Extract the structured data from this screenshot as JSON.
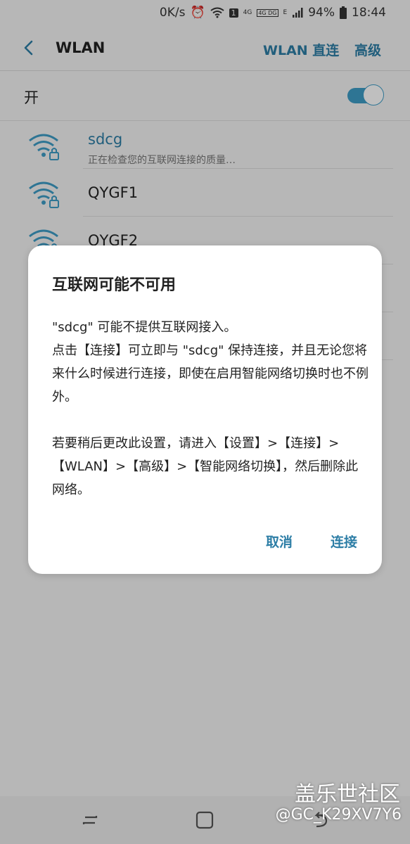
{
  "status_bar": {
    "net_speed": "0K/s",
    "signal_4g": "4G",
    "volte": "4G DG",
    "edge": "E",
    "sim_badge": "1",
    "battery": "94%",
    "time": "18:44"
  },
  "header": {
    "title": "WLAN",
    "wlan_direct": "WLAN 直连",
    "advanced": "高级"
  },
  "master_toggle": {
    "label": "开",
    "state": "on",
    "accent_color": "#3e9cc6"
  },
  "networks": [
    {
      "name": "sdcg",
      "status": "正在检查您的互联网连接的质量…",
      "secured": true
    },
    {
      "name": "QYGF1",
      "status": "",
      "secured": true
    },
    {
      "name": "QYGF2",
      "status": "",
      "secured": true
    }
  ],
  "dialog": {
    "title": "互联网可能不可用",
    "paragraph1": "\"sdcg\" 可能不提供互联网接入。\n点击【连接】可立即与 \"sdcg\" 保持连接，并且无论您将来什么时候进行连接，即使在启用智能网络切换时也不例外。",
    "paragraph2": "若要稍后更改此设置，请进入【设置】>【连接】>【WLAN】>【高级】>【智能网络切换】，然后删除此网络。",
    "cancel": "取消",
    "connect": "连接"
  },
  "watermark": {
    "line1": "盖乐世社区",
    "line2": "@GC_K29XV7Y6"
  }
}
